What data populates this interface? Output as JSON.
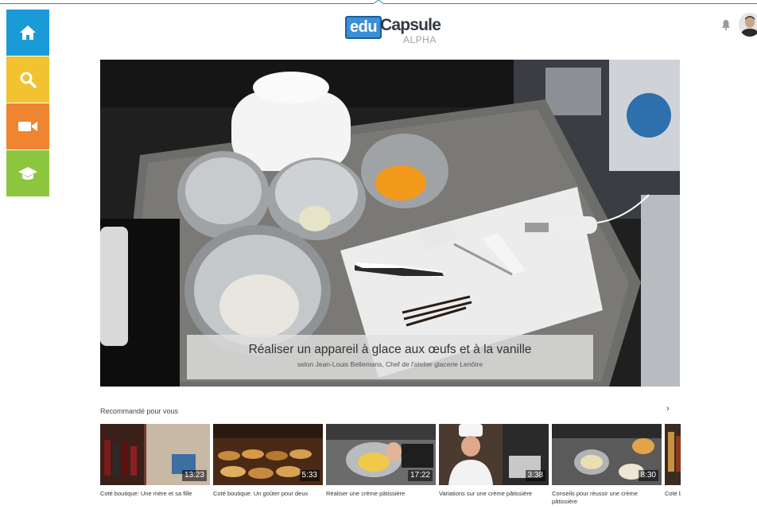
{
  "app": {
    "logo_main": "edu",
    "logo_second": "Capsule",
    "logo_tag": "ALPHA"
  },
  "sidenav": [
    {
      "name": "home-icon",
      "color": "#1b9ad8"
    },
    {
      "name": "search-icon",
      "color": "#f2c230"
    },
    {
      "name": "video-camera-icon",
      "color": "#ef8531"
    },
    {
      "name": "graduation-cap-icon",
      "color": "#8cc63f"
    }
  ],
  "header": {
    "notification_icon": "bell-icon",
    "avatar_icon": "user-avatar"
  },
  "hero": {
    "title": "Réaliser un appareil à glace aux œufs et à la vanille",
    "subtitle": "selon Jean-Louis Bellemans, Chef de l'atelier glacerie Lenôtre"
  },
  "recommended": {
    "heading": "Recommandé pour vous",
    "next_icon": "chevron-right-icon",
    "items": [
      {
        "title": "Coté boutique: Une mère et sa fille",
        "duration": "13:23"
      },
      {
        "title": "Coté boutique: Un goûter pour deux",
        "duration": "5:33"
      },
      {
        "title": "Réaliser une crème pâtissière",
        "duration": "17:22"
      },
      {
        "title": "Variations sur une crème pâtissière",
        "duration": "3:38"
      },
      {
        "title": "Conseils pour réussir une crème pâtissière",
        "duration": "8:30"
      },
      {
        "title": "Coté boutique: Un produit étranger",
        "duration": ""
      }
    ]
  }
}
